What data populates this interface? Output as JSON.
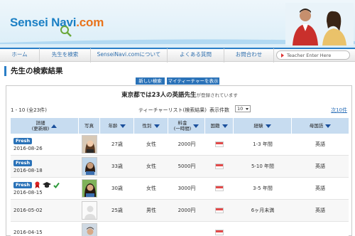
{
  "header": {
    "logo_sensei": "Sensei",
    "logo_navi": "Navi",
    "logo_dotcom": ".com"
  },
  "nav": {
    "items": [
      "ホーム",
      "先生を検索",
      "SenseiNavi.comについて",
      "よくある質問",
      "お問合わせ"
    ],
    "search_placeholder": "Teacher Enter Here"
  },
  "page": {
    "title": "先生の検索結果",
    "tab_new": "新しい検索",
    "tab_mine": "マイティーチャーを表示"
  },
  "results": {
    "lead_prefix": "東京都では",
    "lead_count": "23人の英語先生",
    "lead_suffix": "が登録されています",
    "count_label": "1 - 10 (全23件)",
    "list_title": "ティーチャーリスト(検索結果)",
    "display_label": "表示件数",
    "display_value": "10",
    "next_label": "次10件"
  },
  "table": {
    "headers": {
      "date": "詳細\n(更新順)",
      "photo": "写真",
      "age": "年齢",
      "gender": "性別",
      "fee": "料金\n(一時間)",
      "nation": "国籍",
      "experience": "経験",
      "language": "母国語"
    },
    "rows": [
      {
        "fresh": "Fresh",
        "date": "2016-08-26",
        "age": "27歳",
        "gender": "女性",
        "fee": "2000円",
        "experience": "1-3 年間",
        "language": "英語",
        "badges": false
      },
      {
        "fresh": "Fresh",
        "date": "2016-08-18",
        "age": "33歳",
        "gender": "女性",
        "fee": "5000円",
        "experience": "5-10 年間",
        "language": "英語",
        "badges": false
      },
      {
        "fresh": "Fresh",
        "date": "2016-08-15",
        "age": "30歳",
        "gender": "女性",
        "fee": "3000円",
        "experience": "3-5 年間",
        "language": "英語",
        "badges": true
      },
      {
        "fresh": "",
        "date": "2016-05-02",
        "age": "25歳",
        "gender": "男性",
        "fee": "2000円",
        "experience": "6ヶ月未満",
        "language": "英語",
        "badges": false
      },
      {
        "fresh": "",
        "date": "2016-04-15",
        "age": "",
        "gender": "",
        "fee": "",
        "experience": "",
        "language": "",
        "badges": false
      }
    ]
  },
  "colors": {
    "brand_blue": "#2a72b8",
    "header_row": "#c7dcf0",
    "accent_orange": "#e9731b"
  }
}
